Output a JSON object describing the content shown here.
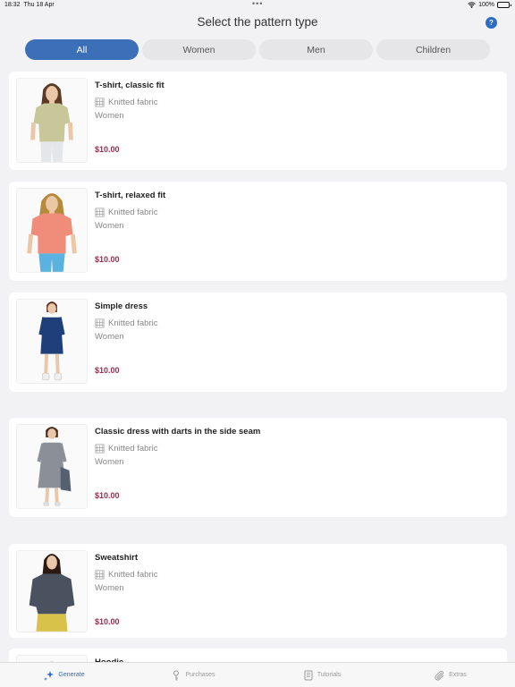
{
  "status": {
    "time": "18:32",
    "date": "Thu 18 Apr",
    "battery": "100%"
  },
  "header": {
    "title": "Select the pattern type",
    "help": "?"
  },
  "filters": [
    {
      "label": "All",
      "active": true
    },
    {
      "label": "Women",
      "active": false
    },
    {
      "label": "Men",
      "active": false
    },
    {
      "label": "Children",
      "active": false
    }
  ],
  "items": [
    {
      "name": "T-shirt, classic fit",
      "fabric": "Knitted fabric",
      "category": "Women",
      "price": "$10.00"
    },
    {
      "name": "T-shirt, relaxed fit",
      "fabric": "Knitted fabric",
      "category": "Women",
      "price": "$10.00"
    },
    {
      "name": "Simple dress",
      "fabric": "Knitted fabric",
      "category": "Women",
      "price": "$10.00"
    },
    {
      "name": "Classic dress with darts in the side seam",
      "fabric": "Knitted fabric",
      "category": "Women",
      "price": "$10.00"
    },
    {
      "name": "Sweatshirt",
      "fabric": "Knitted fabric",
      "category": "Women",
      "price": "$10.00"
    },
    {
      "name": "Hoodie",
      "fabric": "",
      "category": "",
      "price": ""
    }
  ],
  "tabbar": [
    {
      "label": "Generate",
      "icon": "sparkles-icon",
      "active": true
    },
    {
      "label": "Purchases",
      "icon": "key-icon",
      "active": false
    },
    {
      "label": "Tutorials",
      "icon": "book-icon",
      "active": false
    },
    {
      "label": "Extras",
      "icon": "paperclip-icon",
      "active": false
    }
  ],
  "colors": {
    "accent": "#3b6fb8",
    "price": "#9c2a4a",
    "background": "#f2f2f4"
  }
}
